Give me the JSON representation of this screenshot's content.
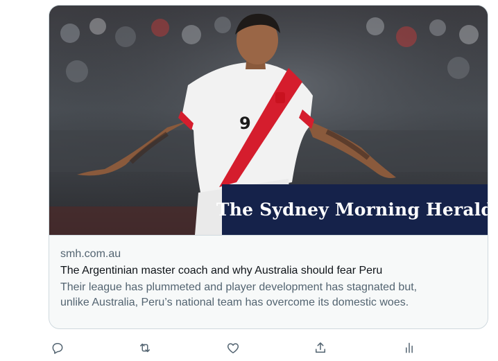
{
  "link_card": {
    "image": {
      "description_icon": "photo-soccer-player",
      "jersey_number": "9",
      "publisher_masthead": "The Sydney Morning Herald"
    },
    "domain": "smh.com.au",
    "title": "The Argentinian master coach and why Australia should fear Peru",
    "description_line1": "Their league has plummeted and player development has stagnated but,",
    "description_line2": "unlike Australia, Peru’s national team has overcome its domestic woes."
  },
  "actions": [
    {
      "icon": "reply-icon"
    },
    {
      "icon": "retweet-icon"
    },
    {
      "icon": "like-icon"
    },
    {
      "icon": "share-icon"
    },
    {
      "icon": "analytics-icon"
    }
  ],
  "colors": {
    "text_primary": "#0f1419",
    "text_secondary": "#536471",
    "border": "#cfd9de",
    "masthead_bg": "#15224a",
    "jersey_red": "#d51d2d"
  }
}
